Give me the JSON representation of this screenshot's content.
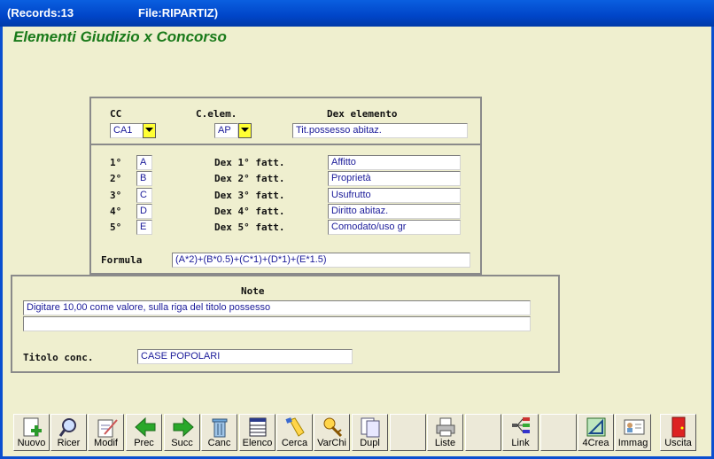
{
  "titlebar": {
    "records": "(Records:13",
    "file": "File:RIPARTIZ)"
  },
  "heading": "Elementi Giudizio x Concorso",
  "top": {
    "cc_label": "CC",
    "celem_label": "C.elem.",
    "dex_label": "Dex elemento",
    "cc_value": "CA1",
    "celem_value": "AP",
    "dex_value": "Tit.possesso abitaz."
  },
  "factors": [
    {
      "num": "1°",
      "code": "A",
      "dex_label": "Dex 1° fatt.",
      "dex_value": "Affitto"
    },
    {
      "num": "2°",
      "code": "B",
      "dex_label": "Dex 2° fatt.",
      "dex_value": "Proprietà"
    },
    {
      "num": "3°",
      "code": "C",
      "dex_label": "Dex 3° fatt.",
      "dex_value": "Usufrutto"
    },
    {
      "num": "4°",
      "code": "D",
      "dex_label": "Dex 4° fatt.",
      "dex_value": "Diritto abitaz."
    },
    {
      "num": "5°",
      "code": "E",
      "dex_label": "Dex 5° fatt.",
      "dex_value": "Comodato/uso gr"
    }
  ],
  "formula": {
    "label": "Formula",
    "value": "(A*2)+(B*0.5)+(C*1)+(D*1)+(E*1.5)"
  },
  "note": {
    "label": "Note",
    "line1": "Digitare 10,00 come valore, sulla riga del titolo possesso",
    "line2": ""
  },
  "titolo": {
    "label": "Titolo conc.",
    "value": "CASE POPOLARI"
  },
  "toolbar": {
    "nuovo": "Nuovo",
    "ricer": "Ricer",
    "modif": "Modif",
    "prec": "Prec",
    "succ": "Succ",
    "canc": "Canc",
    "elenco": "Elenco",
    "cerca": "Cerca",
    "varchi": "VarChi",
    "dupl": "Dupl",
    "liste": "Liste",
    "link": "Link",
    "crea": "4Crea",
    "immag": "Immag",
    "uscita": "Uscita"
  },
  "colors": {
    "title_bar": "#0045c8",
    "heading": "#1a7a1a",
    "background": "#efefcf",
    "combo": "#ffff33",
    "field_text": "#1a1a99"
  }
}
